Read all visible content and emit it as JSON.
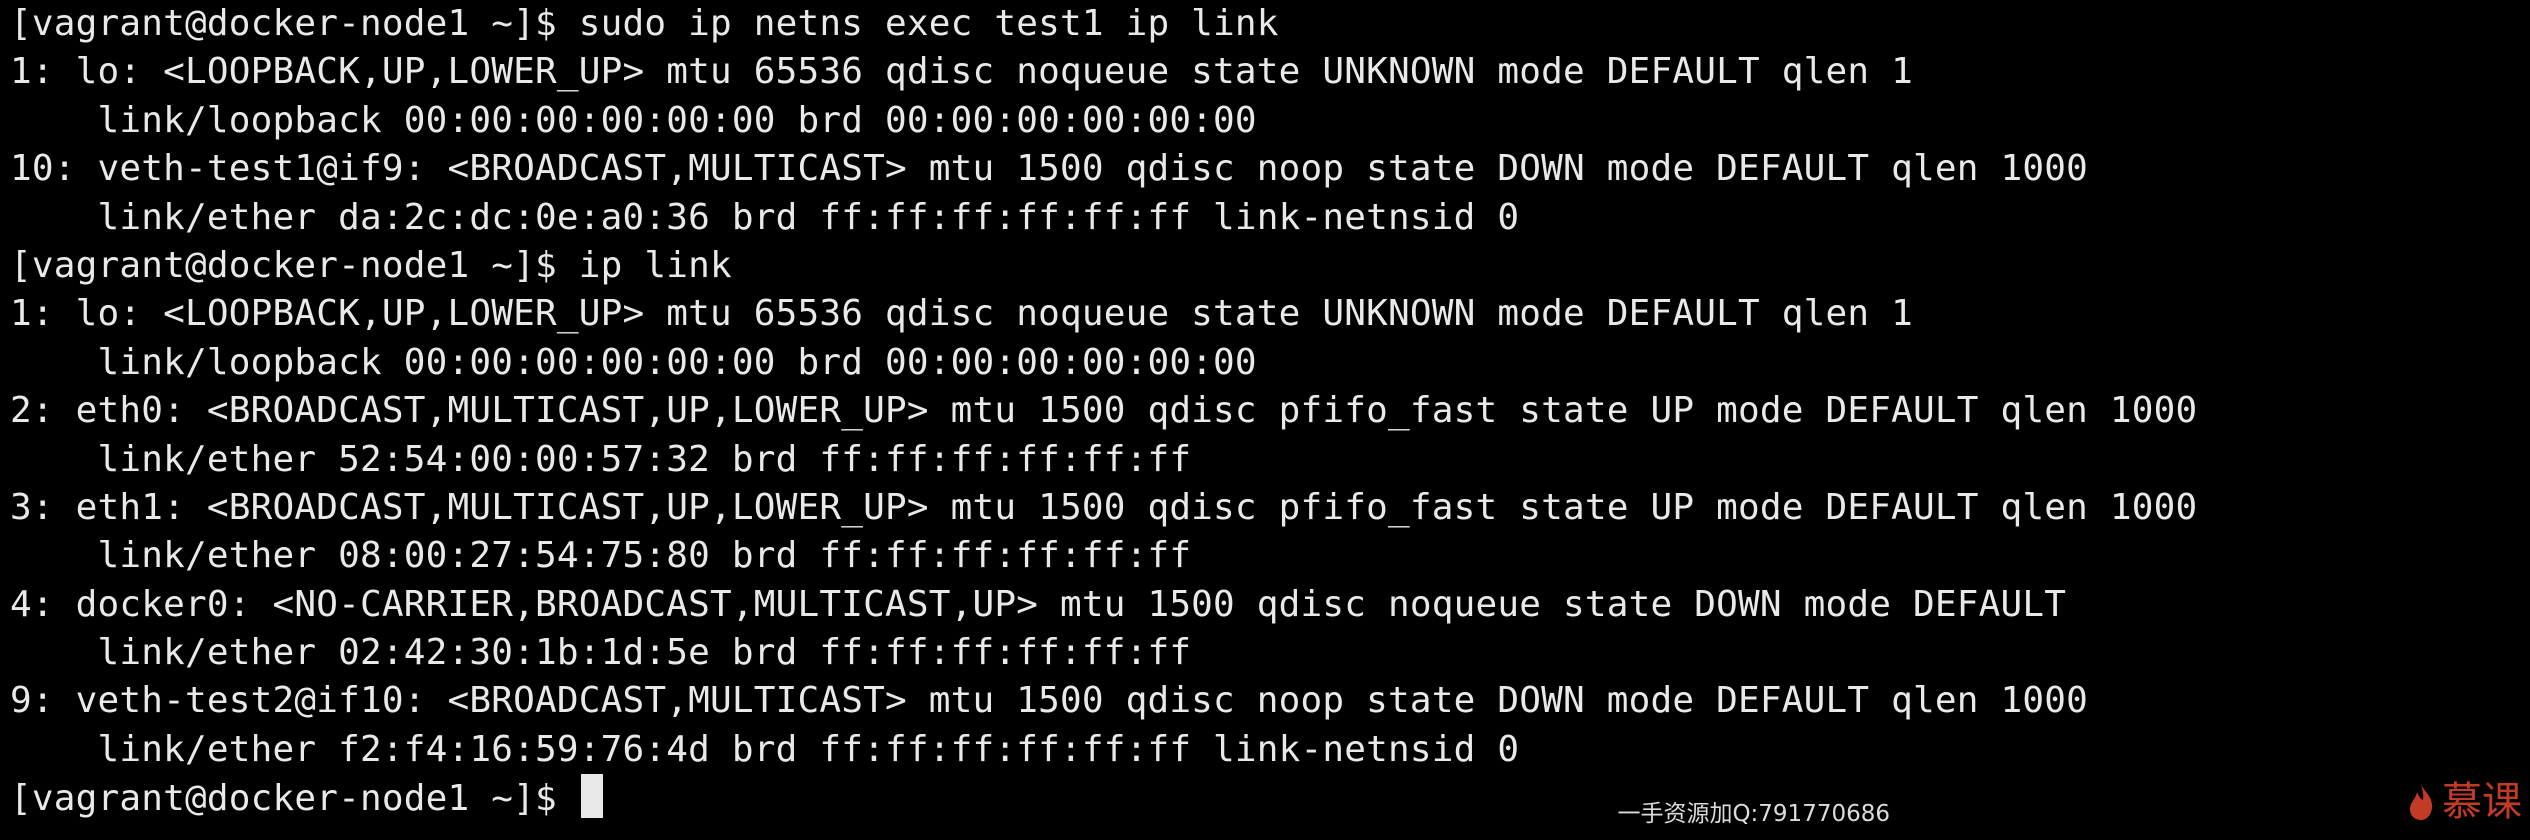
{
  "terminal": {
    "lines": [
      "[vagrant@docker-node1 ~]$ sudo ip netns exec test1 ip link",
      "1: lo: <LOOPBACK,UP,LOWER_UP> mtu 65536 qdisc noqueue state UNKNOWN mode DEFAULT qlen 1",
      "    link/loopback 00:00:00:00:00:00 brd 00:00:00:00:00:00",
      "10: veth-test1@if9: <BROADCAST,MULTICAST> mtu 1500 qdisc noop state DOWN mode DEFAULT qlen 1000",
      "    link/ether da:2c:dc:0e:a0:36 brd ff:ff:ff:ff:ff:ff link-netnsid 0",
      "[vagrant@docker-node1 ~]$ ip link",
      "1: lo: <LOOPBACK,UP,LOWER_UP> mtu 65536 qdisc noqueue state UNKNOWN mode DEFAULT qlen 1",
      "    link/loopback 00:00:00:00:00:00 brd 00:00:00:00:00:00",
      "2: eth0: <BROADCAST,MULTICAST,UP,LOWER_UP> mtu 1500 qdisc pfifo_fast state UP mode DEFAULT qlen 1000",
      "    link/ether 52:54:00:00:57:32 brd ff:ff:ff:ff:ff:ff",
      "3: eth1: <BROADCAST,MULTICAST,UP,LOWER_UP> mtu 1500 qdisc pfifo_fast state UP mode DEFAULT qlen 1000",
      "    link/ether 08:00:27:54:75:80 brd ff:ff:ff:ff:ff:ff",
      "4: docker0: <NO-CARRIER,BROADCAST,MULTICAST,UP> mtu 1500 qdisc noqueue state DOWN mode DEFAULT",
      "    link/ether 02:42:30:1b:1d:5e brd ff:ff:ff:ff:ff:ff",
      "9: veth-test2@if10: <BROADCAST,MULTICAST> mtu 1500 qdisc noop state DOWN mode DEFAULT qlen 1000",
      "    link/ether f2:f4:16:59:76:4d brd ff:ff:ff:ff:ff:ff link-netnsid 0"
    ],
    "prompt": "[vagrant@docker-node1 ~]$ "
  },
  "watermark": {
    "text": "一手资源加Q:791770686"
  },
  "logo": {
    "text": "慕课",
    "icon": "flame-icon"
  },
  "colors": {
    "background": "#000000",
    "foreground": "#e9e9e9",
    "logo": "#d9412b"
  }
}
